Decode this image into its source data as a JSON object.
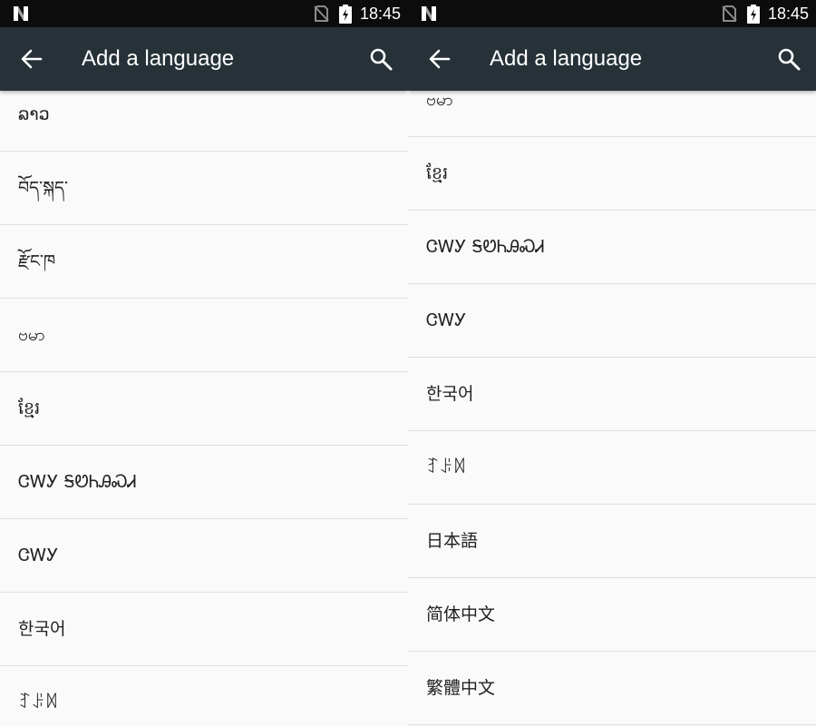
{
  "status_bar": {
    "time": "18:45",
    "icons": [
      "notification-n-icon",
      "no-sim-icon",
      "battery-charging-icon"
    ]
  },
  "app_bar": {
    "title": "Add a language",
    "back_icon": "arrow-back-icon",
    "search_icon": "search-icon",
    "background": "#263238"
  },
  "left_list": {
    "items": [
      {
        "label": "ລາວ"
      },
      {
        "label": "བོད་སྐད་"
      },
      {
        "label": "རྫོང་ཁ"
      },
      {
        "label": "ဗမာ"
      },
      {
        "label": "ខ្មែរ"
      },
      {
        "label": "ᏣᎳᎩ ᎦᏬᏂᎯᏍᏗ"
      },
      {
        "label": "ᏣᎳᎩ"
      },
      {
        "label": "한국어"
      },
      {
        "label": "ꆈꌠꉙ"
      }
    ]
  },
  "right_list": {
    "items": [
      {
        "label": "ဗမာ"
      },
      {
        "label": "ខ្មែរ"
      },
      {
        "label": "ᏣᎳᎩ ᎦᏬᏂᎯᏍᏗ"
      },
      {
        "label": "ᏣᎳᎩ"
      },
      {
        "label": "한국어"
      },
      {
        "label": "ꆈꌠꉙ"
      },
      {
        "label": "日本語"
      },
      {
        "label": "简体中文"
      },
      {
        "label": "繁體中文"
      }
    ]
  }
}
